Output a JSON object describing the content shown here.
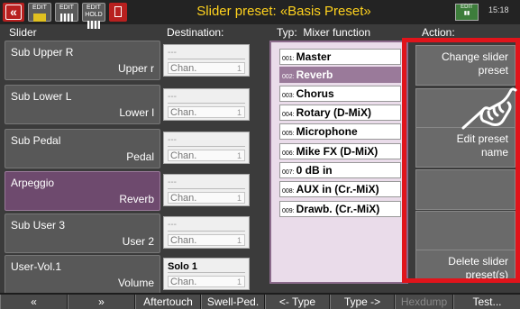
{
  "titlebar": {
    "title": "Slider preset: «Basis Preset»",
    "clock": "15:18",
    "icons": [
      "close-icon",
      "style-edit-icon",
      "edit-icon",
      "edit-hold-icon",
      "delete-icon",
      "registration-icon"
    ],
    "button_labels": {
      "btn2": "EDIT",
      "btn3": "EDIT",
      "btn4": "EDIT HOLD",
      "reg": "EDIT"
    }
  },
  "headers": {
    "slider": "Slider",
    "destination": "Destination:",
    "typ": "Typ:  Mixer function",
    "action": "Action:"
  },
  "sliders": [
    {
      "name": "Sub Upper R",
      "dest": "Upper r",
      "top": "---",
      "chan": "Chan.",
      "chan_num": "1",
      "selected": false
    },
    {
      "name": "Sub Lower L",
      "dest": "Lower l",
      "top": "---",
      "chan": "Chan.",
      "chan_num": "1",
      "selected": false
    },
    {
      "name": "Sub Pedal",
      "dest": "Pedal",
      "top": "---",
      "chan": "Chan.",
      "chan_num": "1",
      "selected": false
    },
    {
      "name": "Arpeggio",
      "dest": "Reverb",
      "top": "---",
      "chan": "Chan.",
      "chan_num": "1",
      "selected": true
    },
    {
      "name": "Sub User 3",
      "dest": "User 2",
      "top": "---",
      "chan": "Chan.",
      "chan_num": "1",
      "selected": false
    },
    {
      "name": "User-Vol.1",
      "dest": "Volume",
      "top": "Solo 1",
      "chan": "Chan.",
      "chan_num": "1",
      "selected": false
    }
  ],
  "mixer_functions": [
    {
      "num": "001:",
      "label": "Master",
      "selected": false
    },
    {
      "num": "002:",
      "label": "Reverb",
      "selected": true
    },
    {
      "num": "003:",
      "label": "Chorus",
      "selected": false
    },
    {
      "num": "004:",
      "label": "Rotary (D-MiX)",
      "selected": false
    },
    {
      "num": "005:",
      "label": "Microphone",
      "selected": false
    },
    {
      "num": "006:",
      "label": "Mike FX (D-MiX)",
      "selected": false
    },
    {
      "num": "007:",
      "label": "0 dB in",
      "selected": false
    },
    {
      "num": "008:",
      "label": "AUX in (Cr.-MiX)",
      "selected": false
    },
    {
      "num": "009:",
      "label": "Drawb. (Cr.-MiX)",
      "selected": false
    }
  ],
  "actions": [
    {
      "line1": "Change slider",
      "line2": "preset"
    },
    {
      "line1": "",
      "line2": ""
    },
    {
      "line1": "Edit preset",
      "line2": "name"
    },
    {
      "line1": "",
      "line2": ""
    },
    {
      "line1": "",
      "line2": ""
    },
    {
      "line1": "Delete slider",
      "line2": "preset(s)"
    }
  ],
  "bottombar": {
    "up": "«",
    "down": "»",
    "aftertouch": "Aftertouch",
    "swell": "Swell-Ped.",
    "type_prev": "<- Type",
    "type_next": "Type ->",
    "hexdump": "Hexdump",
    "test": "Test..."
  },
  "colors": {
    "accent": "#ffd21e",
    "highlight": "#e0141b",
    "selected": "#6e4a6e"
  }
}
